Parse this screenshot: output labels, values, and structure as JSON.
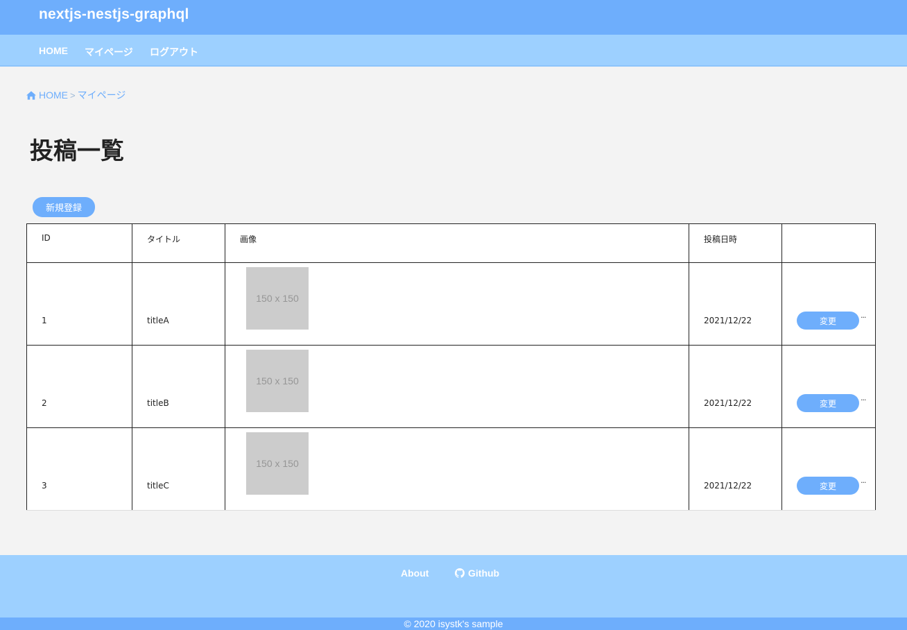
{
  "site": {
    "title": "nextjs-nestjs-graphql"
  },
  "nav": {
    "items": [
      "HOME",
      "マイページ",
      "ログアウト"
    ]
  },
  "breadcrumb": {
    "home_icon": "home-icon",
    "home": "HOME",
    "separator": ">",
    "current": "マイページ"
  },
  "page": {
    "title": "投稿一覧",
    "new_button": "新規登録"
  },
  "table": {
    "headers": [
      "ID",
      "タイトル",
      "画像",
      "投稿日時",
      ""
    ],
    "rows": [
      {
        "id": "1",
        "title": "titleA",
        "image": "150 x 150",
        "date": "2021/12/22",
        "action": "変更"
      },
      {
        "id": "2",
        "title": "titleB",
        "image": "150 x 150",
        "date": "2021/12/22",
        "action": "変更"
      },
      {
        "id": "3",
        "title": "titleC",
        "image": "150 x 150",
        "date": "2021/12/22",
        "action": "変更"
      }
    ]
  },
  "footer": {
    "links": [
      "About",
      "Github"
    ],
    "github_icon": "github-icon",
    "copyright": "© 2020 isystk's sample"
  },
  "colors": {
    "primary": "#6eaefc",
    "light": "#9dd0ff",
    "background": "#f3f3f3",
    "placeholder": "#cccccc"
  }
}
